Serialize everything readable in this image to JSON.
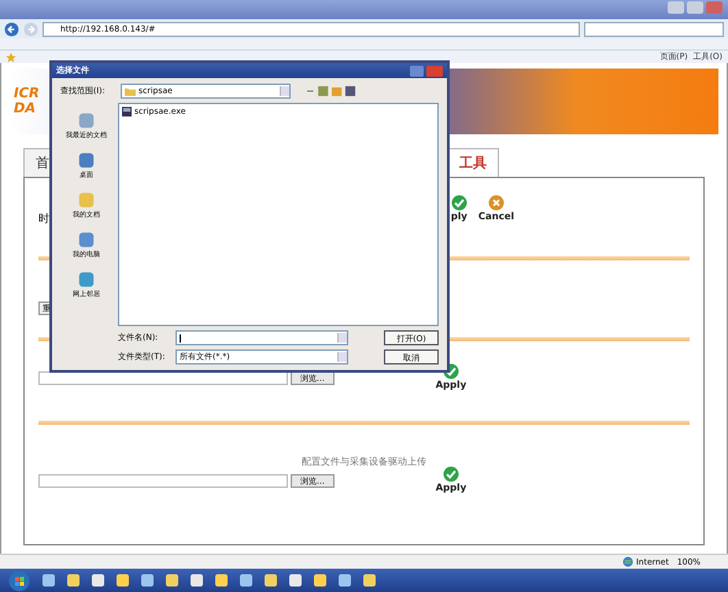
{
  "browser": {
    "address": "http://192.168.0.143/#",
    "command_items": [
      "页面(P)",
      "工具(O)"
    ]
  },
  "page": {
    "logo_lines": [
      "ICR",
      "DA"
    ],
    "tabs": [
      {
        "label": "首",
        "selected": false
      },
      {
        "label": "工具",
        "selected": true
      }
    ],
    "side_label": "时",
    "side_button": "重",
    "actions": [
      "ply",
      "Cancel"
    ],
    "uploads": [
      {
        "browse": "浏览...",
        "apply": "Apply"
      },
      {
        "heading": "配置文件与采集设备驱动上传",
        "browse": "浏览...",
        "apply": "Apply"
      }
    ]
  },
  "dialog": {
    "title": "选择文件",
    "look_in_label": "查找范围(I):",
    "look_in": "scripsae",
    "places": [
      "我最近的文档",
      "桌面",
      "我的文档",
      "我的电脑",
      "网上邻居"
    ],
    "files": [
      "scripsae.exe"
    ],
    "file_name_label": "文件名(N):",
    "file_type_label": "文件类型(T):",
    "file_type": "所有文件(*.*)",
    "open": "打开(O)",
    "cancel": "取消"
  },
  "status_bar": {
    "zone": "Internet",
    "zoom": "100%"
  }
}
